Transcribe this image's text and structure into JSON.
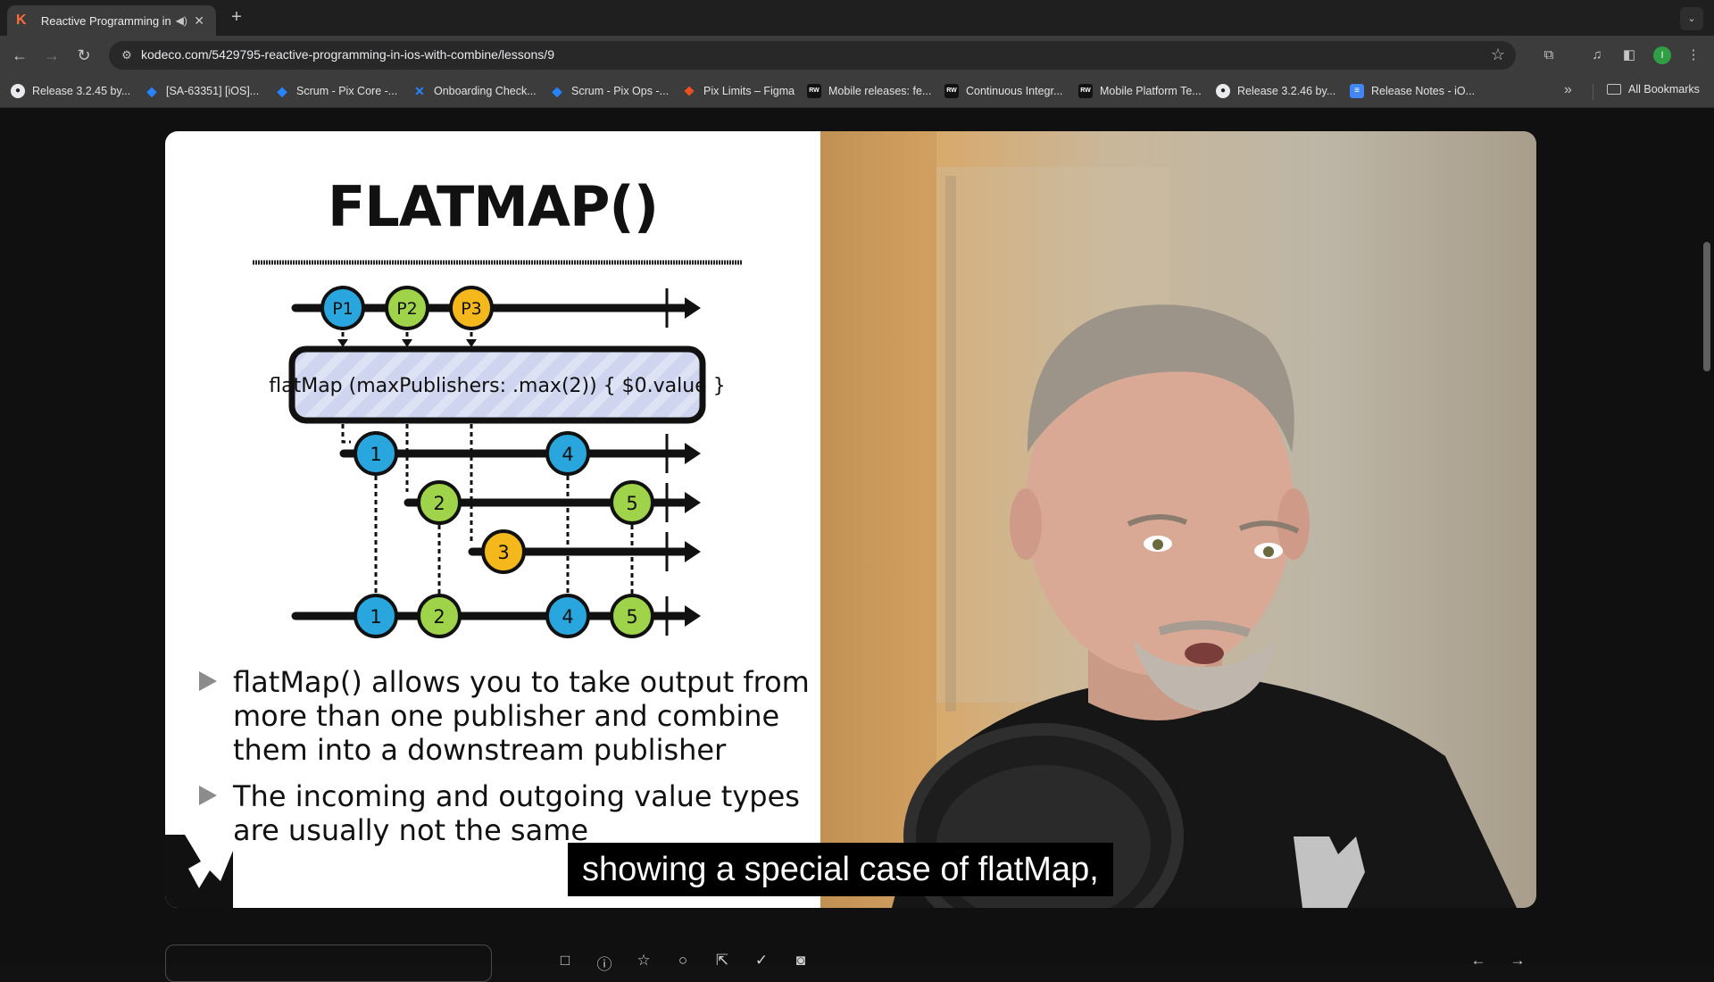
{
  "browser": {
    "tab": {
      "title": "Reactive Programming in",
      "favicon": "kodeco-k-icon"
    },
    "url": "kodeco.com/5429795-reactive-programming-in-ios-with-combine/lessons/9",
    "profile_initial": "I",
    "bookmarks": [
      {
        "label": "Release 3.2.45 by...",
        "icon": "github-icon"
      },
      {
        "label": "[SA-63351] [iOS]...",
        "icon": "jira-icon"
      },
      {
        "label": "Scrum - Pix Core -...",
        "icon": "jira-icon"
      },
      {
        "label": "Onboarding Check...",
        "icon": "confluence-icon"
      },
      {
        "label": "Scrum - Pix Ops -...",
        "icon": "jira-icon"
      },
      {
        "label": "Pix Limits – Figma",
        "icon": "figma-icon"
      },
      {
        "label": "Mobile releases: fe...",
        "icon": "rw-icon"
      },
      {
        "label": "Continuous Integr...",
        "icon": "rw-icon"
      },
      {
        "label": "Mobile Platform Te...",
        "icon": "rw-icon"
      },
      {
        "label": "Release 3.2.46 by...",
        "icon": "github-icon"
      },
      {
        "label": "Release Notes - iO...",
        "icon": "docs-icon"
      }
    ],
    "all_bookmarks": "All Bookmarks"
  },
  "slide": {
    "title": "FLATMAP()",
    "operator": "flatMap (maxPublishers: .max(2)) { $0.value }",
    "inputs": [
      "P1",
      "P2",
      "P3"
    ],
    "inner_values": [
      "1",
      "4",
      "2",
      "5",
      "3"
    ],
    "output_values": [
      "1",
      "2",
      "4",
      "5"
    ],
    "bullets": [
      "flatMap() allows you to take output from more than one publisher and combine them into a downstream publisher",
      "The incoming and outgoing value types are usually not the same"
    ],
    "colors": {
      "blue": "#2aa6df",
      "green": "#9ed34a",
      "yellow": "#f5b81c",
      "operator_fill": "#cfd5ee"
    }
  },
  "caption": "showing a special case of flatMap,"
}
